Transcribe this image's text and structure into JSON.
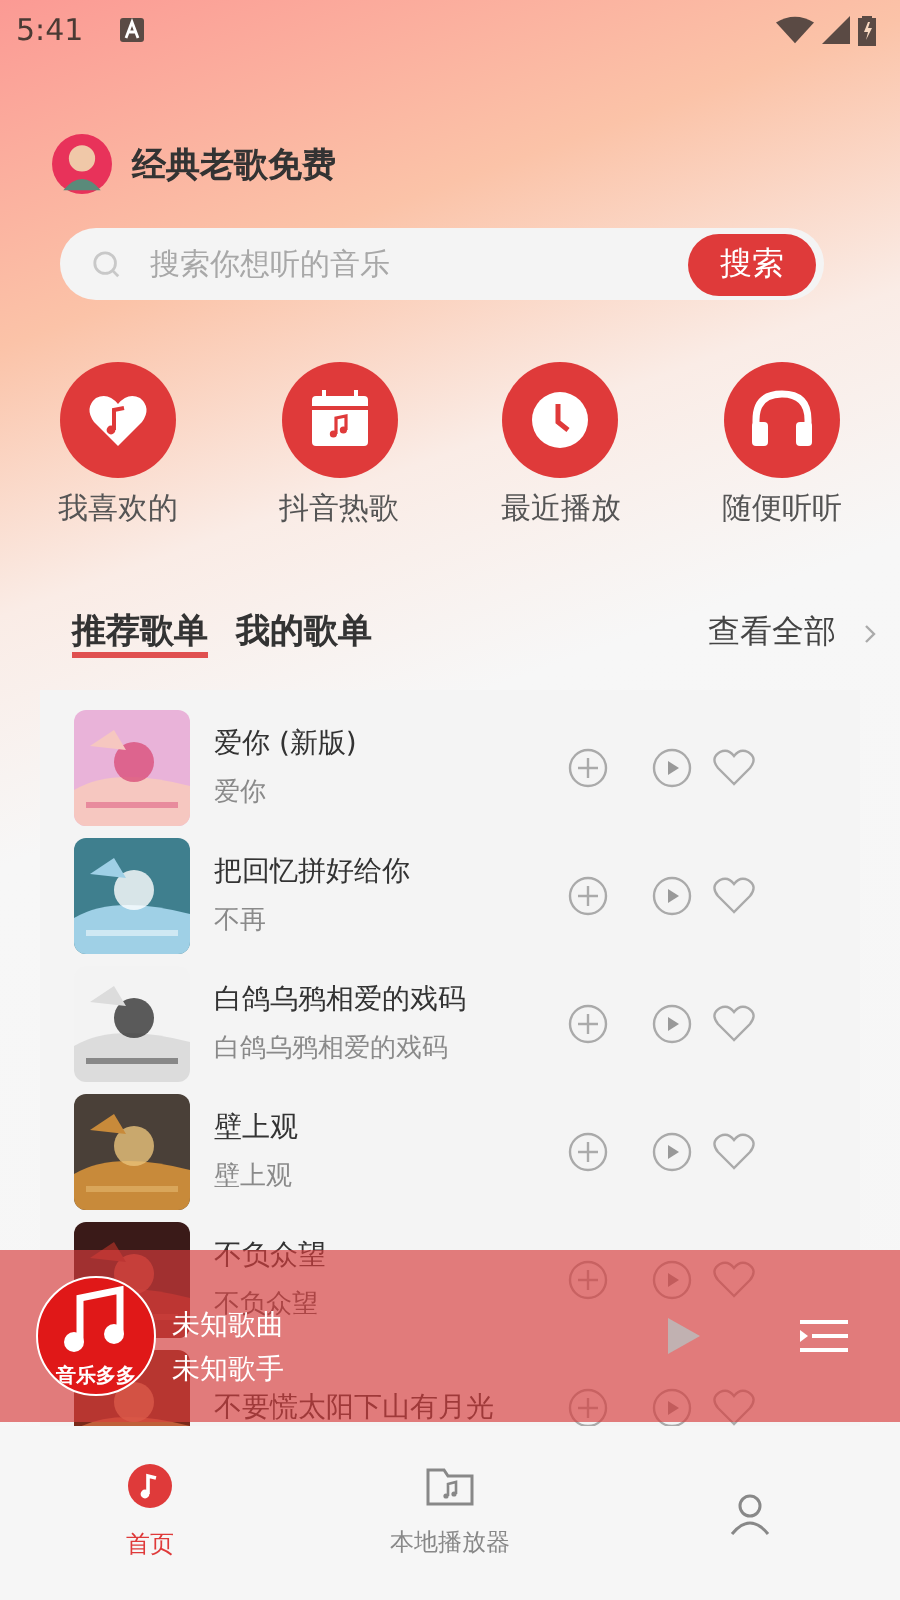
{
  "status_bar": {
    "time": "5:41"
  },
  "header": {
    "title": "经典老歌免费"
  },
  "search": {
    "placeholder": "搜索你想听的音乐",
    "button": "搜索"
  },
  "shortcuts": [
    {
      "kind": "heart",
      "label": "我喜欢的"
    },
    {
      "kind": "calendar",
      "label": "抖音热歌"
    },
    {
      "kind": "clock",
      "label": "最近播放"
    },
    {
      "kind": "headphones",
      "label": "随便听听"
    }
  ],
  "tabs": [
    {
      "label": "推荐歌单",
      "selected": true
    },
    {
      "label": "我的歌单",
      "selected": false
    }
  ],
  "view_all": "查看全部",
  "songs": [
    {
      "title": "爱你 (新版)",
      "artist": "爱你"
    },
    {
      "title": "把回忆拼好给你",
      "artist": "不再"
    },
    {
      "title": "白鸽乌鸦相爱的戏码",
      "artist": "白鸽乌鸦相爱的戏码"
    },
    {
      "title": "壁上观",
      "artist": "壁上观"
    },
    {
      "title": "不负众望",
      "artist": "不负众望"
    },
    {
      "title": "不要慌太阳下山有月光"
    }
  ],
  "player": {
    "logo_text": "音乐多多",
    "song": "未知歌曲",
    "artist": "未知歌手"
  },
  "nav": [
    {
      "kind": "note",
      "label": "首页",
      "selected": true
    },
    {
      "kind": "folder",
      "label": "本地播放器",
      "selected": false
    },
    {
      "kind": "person",
      "selected": false
    }
  ]
}
